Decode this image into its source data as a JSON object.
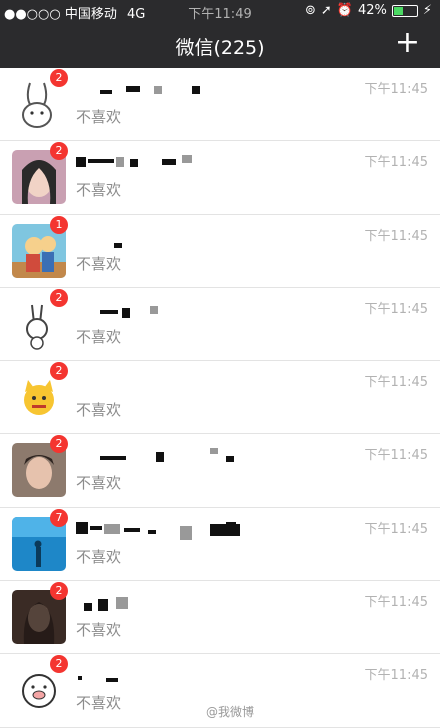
{
  "status_bar": {
    "signal": "●●○○○",
    "carrier": "中国移动",
    "network": "4G",
    "time": "下午11:49",
    "battery": "42%",
    "battery_level": 0.42
  },
  "nav": {
    "title": "微信(225)",
    "add_icon": "plus-icon",
    "add_label": "+"
  },
  "chats": [
    {
      "badge": "2",
      "message": "不喜欢",
      "time": "下午11:45",
      "avatar": "rabbit-sketch"
    },
    {
      "badge": "2",
      "message": "不喜欢",
      "time": "下午11:45",
      "avatar": "girl-photo"
    },
    {
      "badge": "1",
      "message": "不喜欢",
      "time": "下午11:45",
      "avatar": "cartoon-couple"
    },
    {
      "badge": "2",
      "message": "不喜欢",
      "time": "下午11:45",
      "avatar": "bunny-doodle"
    },
    {
      "badge": "2",
      "message": "不喜欢",
      "time": "下午11:45",
      "avatar": "yellow-cat"
    },
    {
      "badge": "2",
      "message": "不喜欢",
      "time": "下午11:45",
      "avatar": "man-photo"
    },
    {
      "badge": "7",
      "message": "不喜欢",
      "time": "下午11:45",
      "avatar": "aquarium-photo"
    },
    {
      "badge": "2",
      "message": "不喜欢",
      "time": "下午11:45",
      "avatar": "woman-photo"
    },
    {
      "badge": "2",
      "message": "不喜欢",
      "time": "下午11:45",
      "avatar": "pig-doodle"
    }
  ],
  "watermark": "@我微博"
}
